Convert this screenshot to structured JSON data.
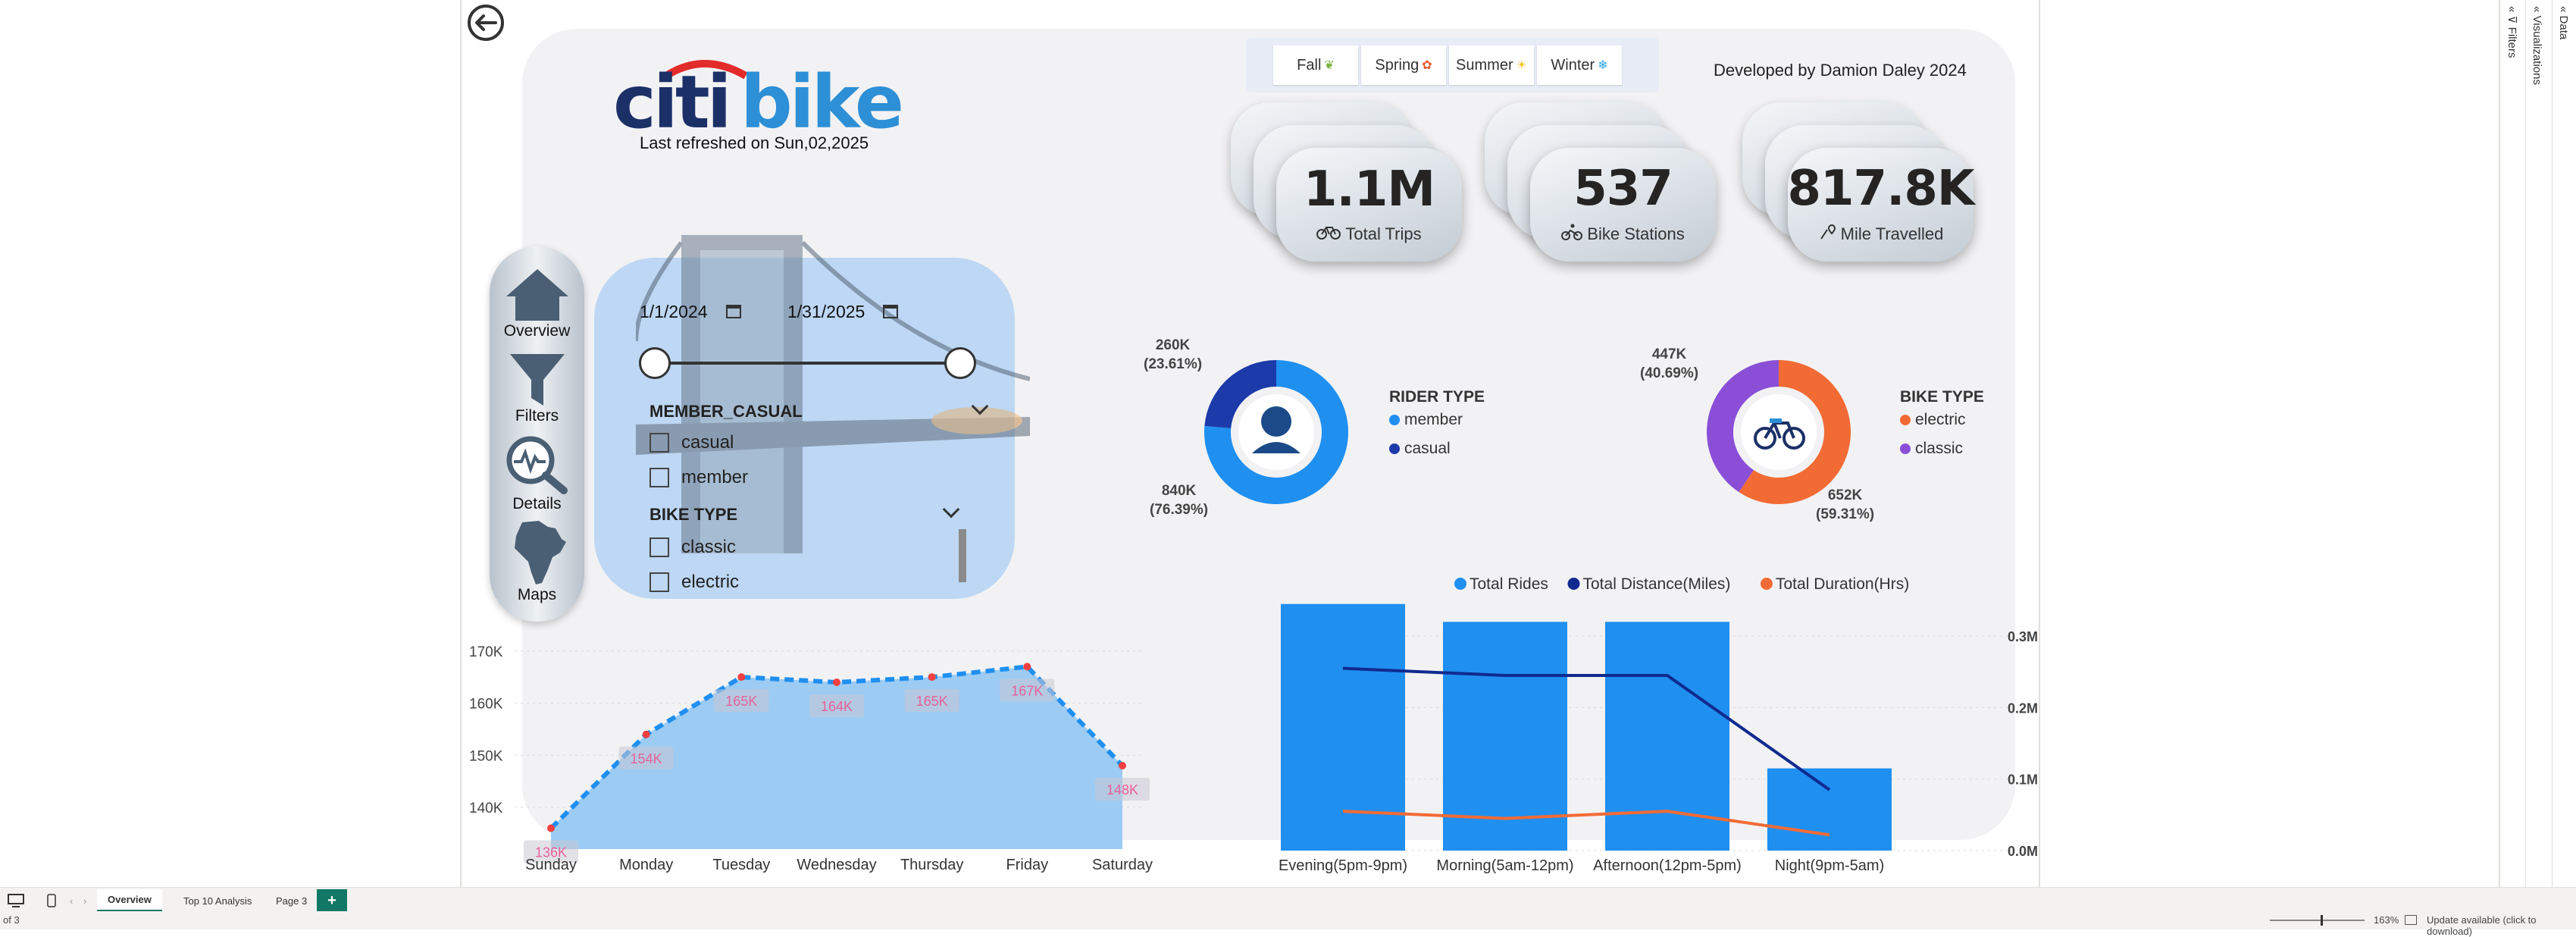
{
  "header": {
    "refresh_text": "Last refreshed on Sun,02,2025",
    "developer": "Developed by Damion Daley 2024",
    "logo_part1": "citi",
    "logo_part2": "bike"
  },
  "seasons": [
    {
      "label": "Fall",
      "icon": "leaf-icon"
    },
    {
      "label": "Spring",
      "icon": "flower-icon"
    },
    {
      "label": "Summer",
      "icon": "sun-icon"
    },
    {
      "label": "Winter",
      "icon": "snowflake-icon"
    }
  ],
  "kpis": {
    "trips": {
      "value": "1.1M",
      "label": "Total Trips"
    },
    "stations": {
      "value": "537",
      "label": "Bike Stations"
    },
    "miles": {
      "value": "817.8K",
      "label": "Mile Travelled"
    }
  },
  "nav": {
    "overview": "Overview",
    "filters": "Filters",
    "details": "Details",
    "maps": "Maps"
  },
  "filters": {
    "date_start": "1/1/2024",
    "date_end": "1/31/2025",
    "member_header": "MEMBER_CASUAL",
    "member_options": [
      "casual",
      "member"
    ],
    "bike_header": "BIKE TYPE",
    "bike_options": [
      "classic",
      "electric"
    ]
  },
  "rider_donut": {
    "legend_title": "RIDER TYPE",
    "legend": [
      "member",
      "casual"
    ],
    "label_top": "260K",
    "label_top_pct": "(23.61%)",
    "label_bottom": "840K",
    "label_bottom_pct": "(76.39%)",
    "colors": {
      "member": "#1f8ff0",
      "casual": "#1c3aa9"
    }
  },
  "bike_donut": {
    "legend_title": "BIKE TYPE",
    "legend": [
      "electric",
      "classic"
    ],
    "label_top": "447K",
    "label_top_pct": "(40.69%)",
    "label_bottom": "652K",
    "label_bottom_pct": "(59.31%)",
    "colors": {
      "electric": "#f26b35",
      "classic": "#8a4fd6"
    }
  },
  "chart_data": [
    {
      "type": "pie",
      "title": "RIDER TYPE",
      "categories": [
        "member",
        "casual"
      ],
      "values": [
        840,
        260
      ],
      "percent": [
        76.39,
        23.61
      ]
    },
    {
      "type": "pie",
      "title": "BIKE TYPE",
      "categories": [
        "electric",
        "classic"
      ],
      "values": [
        652,
        447
      ],
      "percent": [
        59.31,
        40.69
      ]
    },
    {
      "type": "area",
      "categories": [
        "Sunday",
        "Monday",
        "Tuesday",
        "Wednesday",
        "Thursday",
        "Friday",
        "Saturday"
      ],
      "values": [
        136,
        154,
        165,
        164,
        165,
        167,
        148
      ],
      "data_labels": [
        "136K",
        "154K",
        "165K",
        "164K",
        "165K",
        "167K",
        "148K"
      ],
      "y_ticks": [
        "140K",
        "150K",
        "160K",
        "170K"
      ],
      "ylim": [
        132,
        172
      ],
      "xlabel": "",
      "ylabel": ""
    },
    {
      "type": "bar",
      "categories": [
        "Evening(5pm-9pm)",
        "Morning(5am-12pm)",
        "Afternoon(12pm-5pm)",
        "Night(9pm-5am)"
      ],
      "series": [
        {
          "name": "Total Rides",
          "type": "bar",
          "values": [
            0.345,
            0.32,
            0.32,
            0.115
          ]
        },
        {
          "name": "Total Distance(Miles)",
          "type": "line",
          "values": [
            0.255,
            0.245,
            0.245,
            0.085
          ]
        },
        {
          "name": "Total Duration(Hrs)",
          "type": "line",
          "values": [
            0.055,
            0.045,
            0.055,
            0.022
          ]
        }
      ],
      "y_ticks": [
        "0.0M",
        "0.1M",
        "0.2M",
        "0.3M"
      ],
      "ylim": [
        0,
        0.35
      ],
      "colors": {
        "Total Rides": "#1f8ff0",
        "Total Distance(Miles)": "#102a8f",
        "Total Duration(Hrs)": "#f26b35"
      }
    }
  ],
  "pages": [
    "Overview",
    "Top 10 Analysis",
    "Page 3"
  ],
  "right_panes": [
    "Filters",
    "Visualizations",
    "Data"
  ],
  "status": {
    "page_info": "of 3",
    "zoom": "163%",
    "update": "Update available (click to download)"
  }
}
